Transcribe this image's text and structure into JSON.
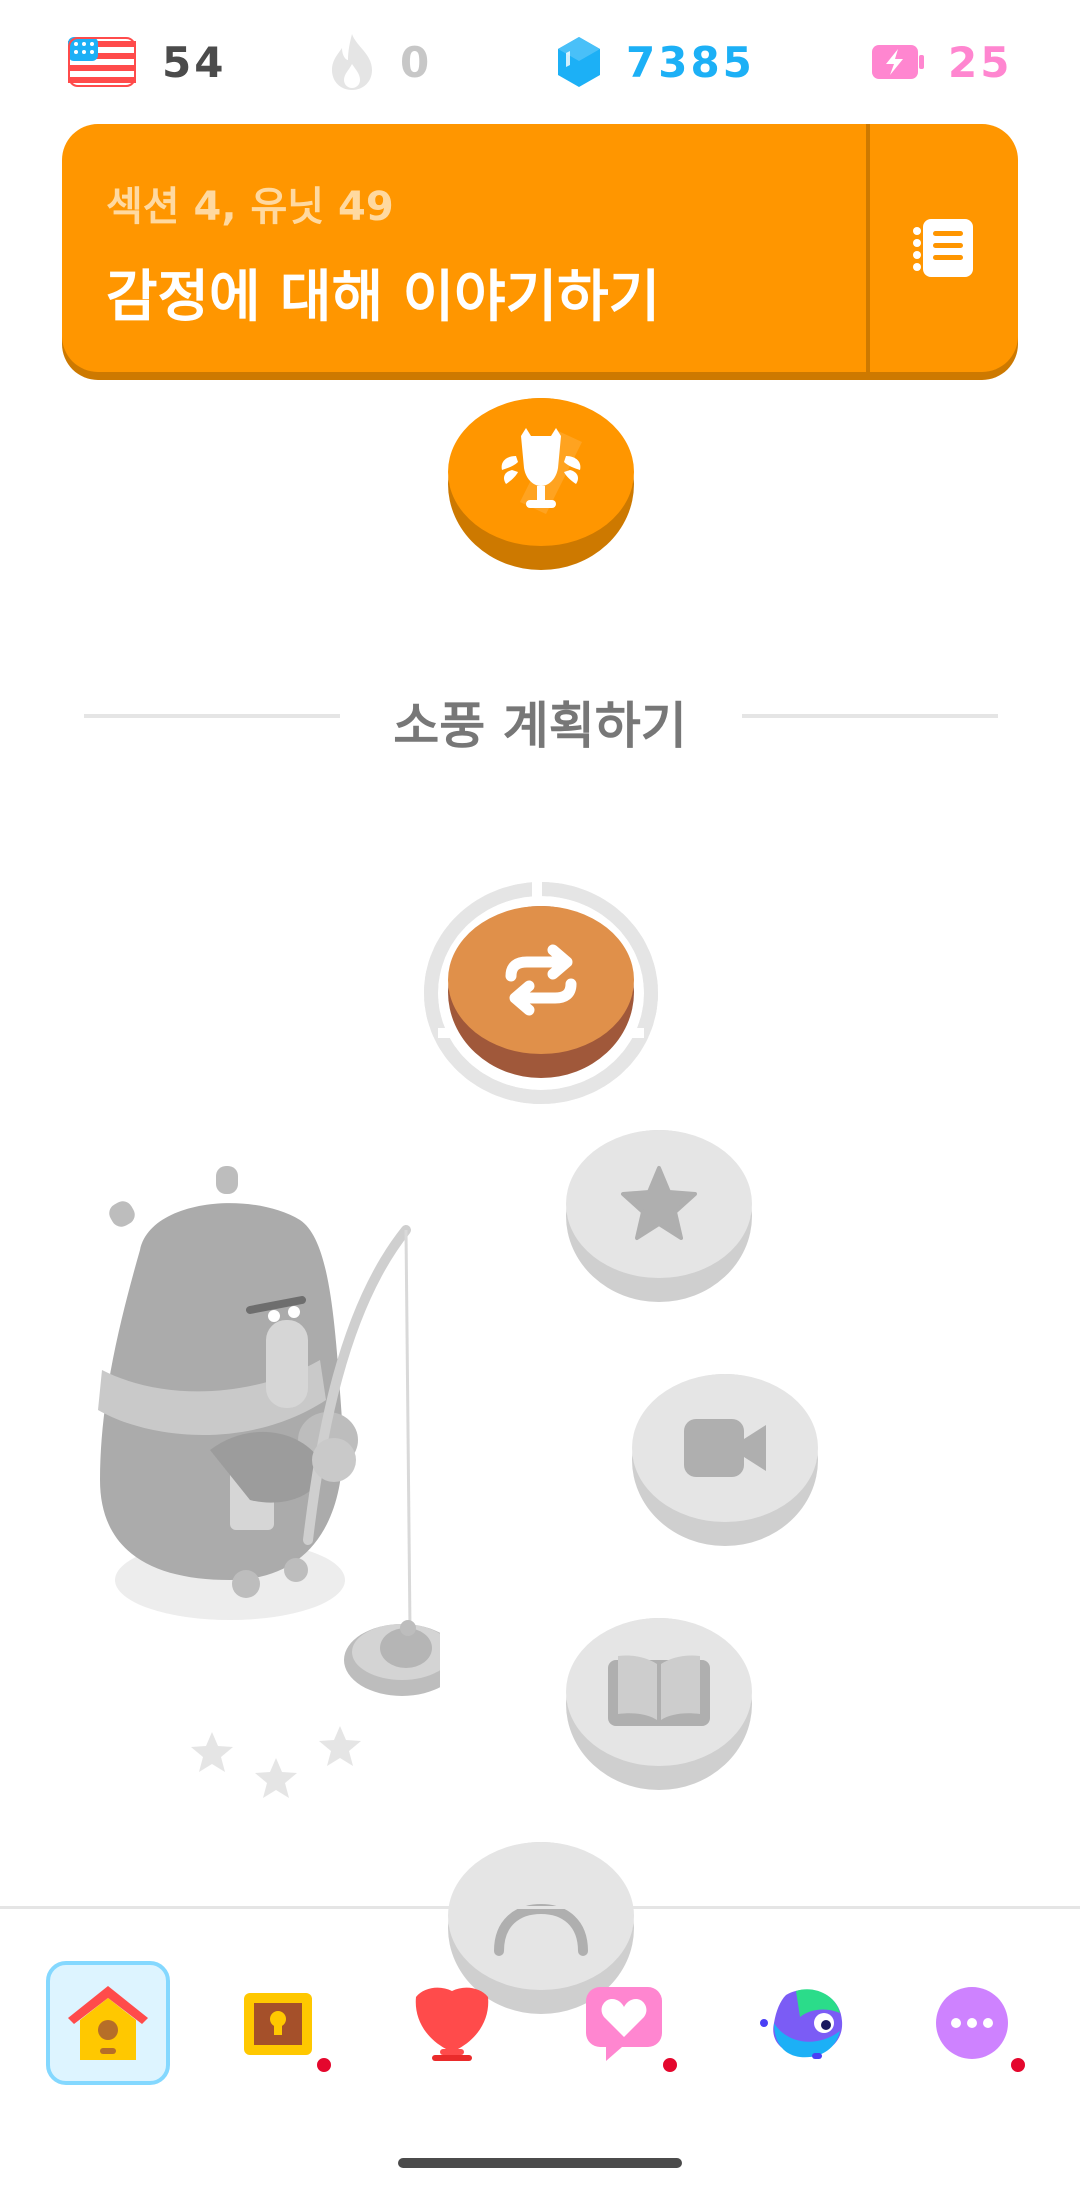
{
  "stats": {
    "language": {
      "icon": "us-flag-icon",
      "value": "54"
    },
    "streak": {
      "icon": "flame-icon",
      "value": "0"
    },
    "gems": {
      "icon": "gem-icon",
      "value": "7385"
    },
    "energy": {
      "icon": "battery-icon",
      "value": "25"
    }
  },
  "unit": {
    "section_unit": "섹션 4, 유닛 49",
    "title": "감정에 대해 이야기하기",
    "guide_icon": "guidebook-icon"
  },
  "path": {
    "section_title": "소풍 계획하기",
    "nodes": [
      {
        "type": "trophy",
        "state": "completed",
        "icon": "trophy-icon"
      },
      {
        "type": "review",
        "state": "active",
        "icon": "repeat-icon"
      },
      {
        "type": "lesson",
        "state": "locked",
        "icon": "star-icon"
      },
      {
        "type": "video",
        "state": "locked",
        "icon": "video-icon"
      },
      {
        "type": "story",
        "state": "locked",
        "icon": "book-icon"
      }
    ]
  },
  "nav": {
    "tabs": [
      {
        "name": "learn",
        "icon": "home-icon",
        "active": true,
        "badge": false
      },
      {
        "name": "chest",
        "icon": "treasure-chest-icon",
        "active": false,
        "badge": true
      },
      {
        "name": "leagues",
        "icon": "shield-icon",
        "active": false,
        "badge": false
      },
      {
        "name": "friends",
        "icon": "heart-chat-icon",
        "active": false,
        "badge": true
      },
      {
        "name": "max",
        "icon": "duo-max-icon",
        "active": false,
        "badge": false
      },
      {
        "name": "more",
        "icon": "more-icon",
        "active": false,
        "badge": true
      }
    ]
  },
  "colors": {
    "unit_orange": "#ff9600",
    "unit_orange_dark": "#cd7900",
    "gem_blue": "#1cb0f6",
    "energy_pink": "#ff86d0",
    "locked_gray": "#e5e5e5",
    "badge_red": "#e4072d"
  }
}
